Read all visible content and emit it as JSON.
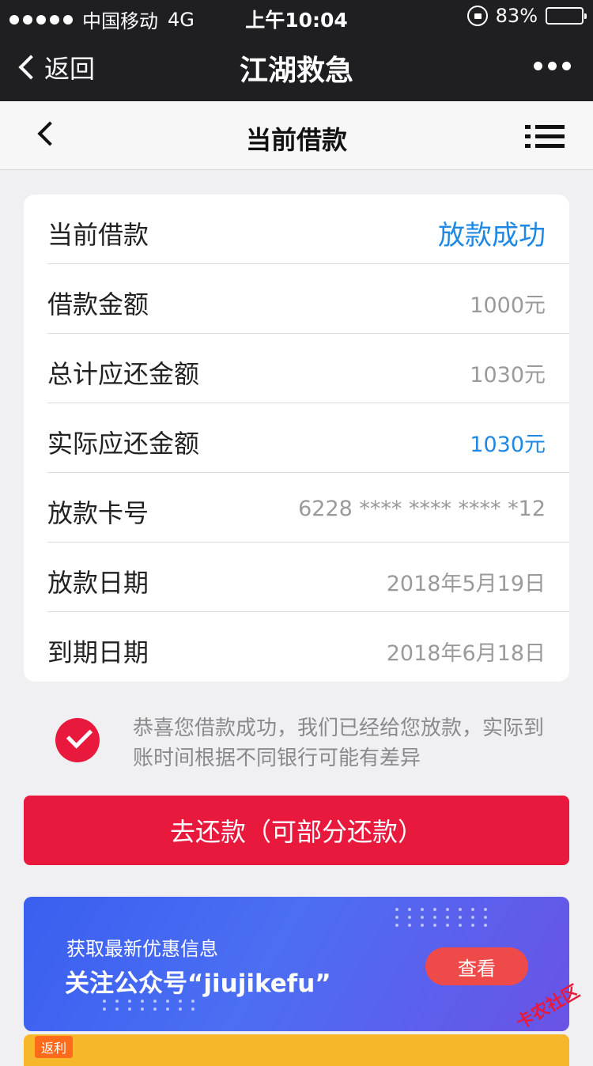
{
  "status_bar": {
    "carrier": "中国移动",
    "network": "4G",
    "time": "上午10:04",
    "battery": "83%"
  },
  "top_nav": {
    "back_label": "返回",
    "title": "江湖救急"
  },
  "sub_nav": {
    "title": "当前借款"
  },
  "loan": {
    "header_label": "当前借款",
    "status": "放款成功",
    "rows": [
      {
        "label": "借款金额",
        "value": "1000元"
      },
      {
        "label": "总计应还金额",
        "value": "1030元"
      },
      {
        "label": "实际应还金额",
        "value": "1030元"
      },
      {
        "label": "放款卡号",
        "value": "6228 **** **** **** *12"
      },
      {
        "label": "放款日期",
        "value": "2018年5月19日"
      },
      {
        "label": "到期日期",
        "value": "2018年6月18日"
      }
    ]
  },
  "notice": {
    "text": "恭喜您借款成功，我们已经给您放款，实际到账时间根据不同银行可能有差异"
  },
  "repay_button": {
    "label": "去还款（可部分还款）"
  },
  "banner": {
    "line1": "获取最新优惠信息",
    "line2": "关注公众号“jiujikefu”",
    "button_label": "查看"
  },
  "bottom_banner": {
    "badge": "返利"
  },
  "watermark": "卡农社区",
  "colors": {
    "accent_red": "#e8193c",
    "link_blue": "#1e88e5",
    "nav_bg": "#1f1f21"
  }
}
